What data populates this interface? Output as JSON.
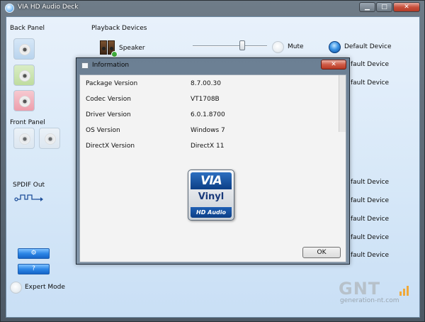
{
  "window": {
    "title": "VIA HD Audio Deck",
    "buttons": {
      "minimize": "▁",
      "maximize": "□",
      "close": "✕"
    }
  },
  "left_panel": {
    "back_panel_label": "Back Panel",
    "front_panel_label": "Front Panel",
    "spdif_label": "SPDIF Out",
    "expert_mode_label": "Expert Mode"
  },
  "playback": {
    "header": "Playback Devices",
    "device_name": "Speaker",
    "mute_label": "Mute",
    "default_device_label": "Default Device",
    "repeated_default_labels": [
      "fault Device",
      "fault Device",
      "fault Device",
      "fault Device",
      "fault Device",
      "fault Device",
      "fault Device"
    ]
  },
  "dialog": {
    "title": "Information",
    "close_glyph": "✕",
    "rows": [
      {
        "label": "Package Version",
        "value": "8.7.00.30"
      },
      {
        "label": "Codec Version",
        "value": "VT1708B"
      },
      {
        "label": "Driver Version",
        "value": "6.0.1.8700"
      },
      {
        "label": "OS Version",
        "value": "Windows 7"
      },
      {
        "label": "DirectX Version",
        "value": "DirectX 11"
      }
    ],
    "logo": {
      "top": "VIA",
      "word": "Vinyl",
      "sub": "HD Audio"
    },
    "ok_label": "OK"
  },
  "watermark": {
    "big": "GNT",
    "small": "generation-nt.com"
  },
  "colors": {
    "accent_blue": "#2c86e6",
    "close_red": "#c7503c",
    "watermark_orange": "#f0a93a"
  },
  "icons": [
    "app-icon",
    "speaker-icon",
    "spdif-icon",
    "jack-icon",
    "info-icon"
  ]
}
